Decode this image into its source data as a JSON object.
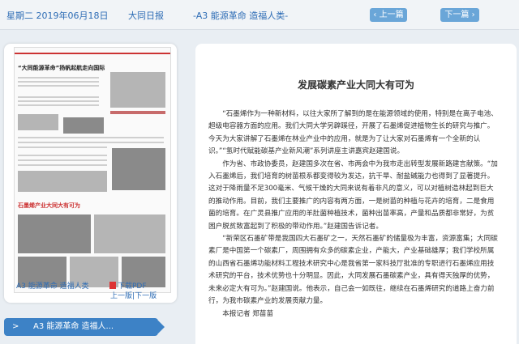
{
  "topbar": {
    "date": "星期二 2019年06月18日",
    "paper": "大同日报",
    "edition": "-A3 能源革命 造福人类-",
    "prev_label": "上一篇",
    "next_label": "下一篇"
  },
  "left_panel": {
    "page_caption": "A3 能源革命 造福人类",
    "pdf_label": "下载PDF",
    "prev_page": "上一版",
    "next_page": "下一版",
    "selected_article": "A3 能源革命 造福人..."
  },
  "article": {
    "title": "发展碳素产业大同大有可为",
    "paragraphs": [
      "“石墨烯作为一种新材料，以往大家所了解到的是在能源领域的使用，特别是在离子电池、超级电容器方面的应用。我们大同大学另辟蹊径，开展了石墨烯促进植物生长的研究与推广。今天为大家讲解了石墨烯在林业产业中的应用，就是为了让大家对石墨烯有一个全新的认识。”“氢时代赋能碳基产业新风潮”系列讲座主讲嘉宾赵建国说。",
      "作为省、市政协委员，赵建国多次在省、市两会中为我市走出转型发展新路建言献策。“加入石墨烯后，我们培育的树苗根系都变得较为发达，抗干旱、耐盐碱能力也得到了显著提升。这对于降雨量不足300毫米、气候干燥的大同来说有着非凡的意义，可以对植树造林起到巨大的推动作用。目前，我们主要推广的内容有两方面，一是树苗的种植与花卉的培育，二是食用菌的培育。在广灵县推广应用的羊肚菌种植技术，菌种出苗率高，产量和品质都非常好，为贫困户脱贫致富起到了积极的带动作用。”赵建国告诉记者。",
      "“新荣区石墨矿带是我国四大石墨矿之一，天然石墨矿的储量极为丰富，资源富集；大同碳素厂是中国第一个碳素厂，周围拥有众多的碳素企业，产能大，产业基础雄厚；我们学校所属的山西省石墨烯功能材料工程技术研究中心是我省第一家科技厅批准的专职进行石墨烯应用技术研究的平台，技术优势也十分明显。因此，大同发展石墨碳素产业，具有得天独厚的优势，未来必定大有可为。”赵建国说。他表示，自己会一如既往，继续在石墨烯研究的道路上奋力前行，为我市碳素产业的发展贡献力量。",
      "本报记者 郑苗苗"
    ]
  },
  "thumbnail": {
    "headline_1": "“大同能源革命”扬帆起航走向国际",
    "headline_2": "石墨烯产业大同大有可为",
    "colors": {
      "accent": "#c33333"
    }
  },
  "colors": {
    "link": "#2d6cb5",
    "button": "#6aa6d8",
    "selected": "#3d82c6",
    "background": "#e9eef3"
  }
}
